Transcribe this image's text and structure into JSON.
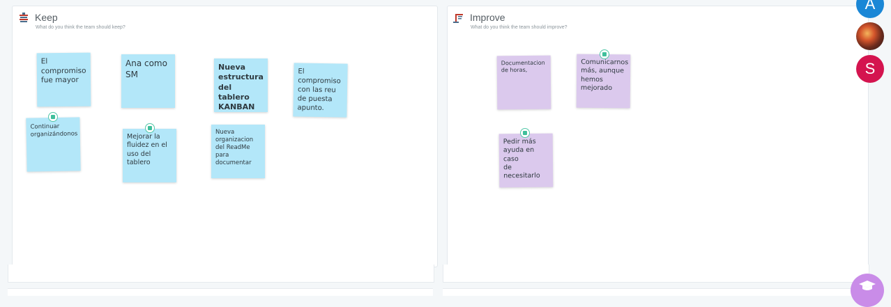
{
  "keep": {
    "title": "Keep",
    "subtitle": "What do you think the team should keep?",
    "icon": "keep-icon",
    "notes": [
      {
        "text": "El\ncompromiso\nfue mayor",
        "color": "#b3e7f9",
        "vote": false
      },
      {
        "text": "Ana como\nSM",
        "color": "#b3e7f9",
        "vote": false
      },
      {
        "text": "Nueva\nestructura\ndel tablero\nKANBAN",
        "color": "#b3e7f9",
        "vote": false
      },
      {
        "text": "El\ncompromiso\ncon  las reu\nde puesta\napunto.",
        "color": "#b3e7f9",
        "vote": false
      },
      {
        "text": "Continuar\norganizándonos",
        "color": "#b3e7f9",
        "vote": true
      },
      {
        "text": "Mejorar la\nfluidez en el\nuso del tablero",
        "color": "#b3e7f9",
        "vote": true
      },
      {
        "text": "Nueva\norganizacion\ndel ReadMe\npara\ndocumentar",
        "color": "#b3e7f9",
        "vote": false
      }
    ]
  },
  "improve": {
    "title": "Improve",
    "subtitle": "What do you think the team should improve?",
    "icon": "improve-icon",
    "notes": [
      {
        "text": "Documentacion\nde horas,",
        "color": "#dbc9ed",
        "vote": false
      },
      {
        "text": "Comunicarnos\nmás, aunque\nhemos\nmejorado",
        "color": "#dbc9ed",
        "vote": true
      },
      {
        "text": "Pedir más\nayuda en caso\nde necesitarlo",
        "color": "#dbc9ed",
        "vote": true
      }
    ]
  },
  "participants": [
    {
      "initial": "A",
      "color": "#1a87d6"
    },
    {
      "initial": "",
      "color": "#d4552b"
    },
    {
      "initial": "S",
      "color": "#d4144f"
    }
  ],
  "help": {
    "icon": "graduation-cap-icon",
    "color": "#c98ce8"
  }
}
